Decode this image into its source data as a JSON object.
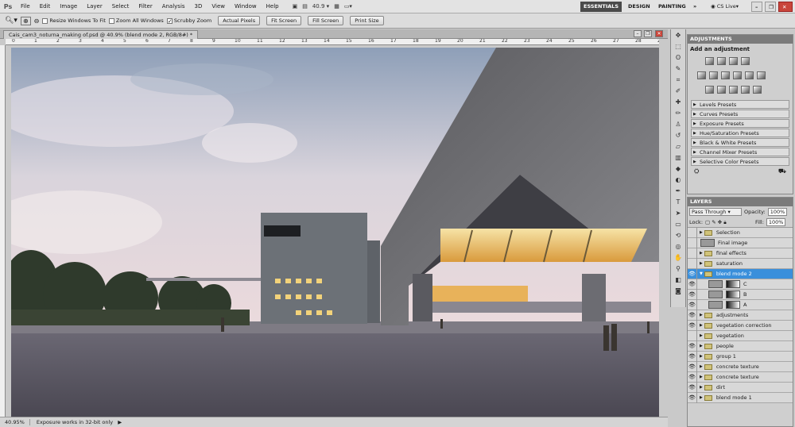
{
  "app": {
    "logo": "Ps"
  },
  "menu": [
    "File",
    "Edit",
    "Image",
    "Layer",
    "Select",
    "Filter",
    "Analysis",
    "3D",
    "View",
    "Window",
    "Help"
  ],
  "menubar": {
    "zoom_value": "40.9",
    "workspaces": [
      "ESSENTIALS",
      "DESIGN",
      "PAINTING"
    ],
    "more": "»",
    "cs_live": "CS Live"
  },
  "options": {
    "resize_windows": "Resize Windows To Fit",
    "zoom_all_windows": "Zoom All Windows",
    "scrubby_zoom": "Scrubby Zoom",
    "buttons": [
      "Actual Pixels",
      "Fit Screen",
      "Fill Screen",
      "Print Size"
    ]
  },
  "document": {
    "title": "Cais_cam3_noturna_making of.psd @ 40.9% (blend mode 2, RGB/8#) *"
  },
  "ruler": {
    "top": [
      "0",
      "1",
      "2",
      "3",
      "4",
      "5",
      "6",
      "7",
      "8",
      "9",
      "10",
      "11",
      "12",
      "13",
      "14",
      "15",
      "16",
      "17",
      "18",
      "19",
      "20",
      "21",
      "22",
      "23",
      "24",
      "25",
      "26",
      "27",
      "28",
      "29"
    ]
  },
  "status": {
    "zoom": "40.95%",
    "message": "Exposure works in 32-bit only"
  },
  "adjustments": {
    "tab": "ADJUSTMENTS",
    "heading": "Add an adjustment",
    "presets": [
      "Levels Presets",
      "Curves Presets",
      "Exposure Presets",
      "Hue/Saturation Presets",
      "Black & White Presets",
      "Channel Mixer Presets",
      "Selective Color Presets"
    ]
  },
  "layers": {
    "tab": "LAYERS",
    "blend_mode": "Pass Through",
    "opacity_label": "Opacity:",
    "opacity": "100%",
    "lock_label": "Lock:",
    "fill_label": "Fill:",
    "fill": "100%",
    "items": [
      {
        "name": "Selection",
        "kind": "group",
        "visible": false
      },
      {
        "name": "Final image",
        "kind": "image",
        "visible": false
      },
      {
        "name": "final effects",
        "kind": "group",
        "visible": false
      },
      {
        "name": "saturation",
        "kind": "group",
        "visible": false
      },
      {
        "name": "blend mode 2",
        "kind": "group",
        "visible": true,
        "selected": true
      },
      {
        "name": "C",
        "kind": "mask",
        "visible": true
      },
      {
        "name": "B",
        "kind": "mask",
        "visible": true
      },
      {
        "name": "A",
        "kind": "mask",
        "visible": true
      },
      {
        "name": "adjustments",
        "kind": "group",
        "visible": true
      },
      {
        "name": "vegetation correction",
        "kind": "group",
        "visible": true
      },
      {
        "name": "vegetation",
        "kind": "group",
        "visible": false
      },
      {
        "name": "people",
        "kind": "group",
        "visible": true
      },
      {
        "name": "group 1",
        "kind": "group",
        "visible": true
      },
      {
        "name": "concrete texture",
        "kind": "group",
        "visible": true
      },
      {
        "name": "concrete texture",
        "kind": "group",
        "visible": true
      },
      {
        "name": "dirt",
        "kind": "group",
        "visible": true
      },
      {
        "name": "blend mode 1",
        "kind": "group",
        "visible": true
      }
    ]
  },
  "colors": {
    "selected": "#3a8fdb",
    "panel_tab": "#7b7b7b",
    "workspace_active": "#4a4a4a"
  }
}
